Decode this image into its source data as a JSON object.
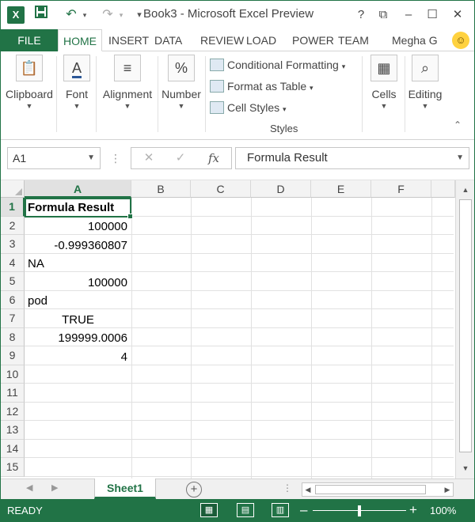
{
  "window": {
    "title": "Book3 - Microsoft Excel Preview",
    "logo": "X",
    "user": "Megha G"
  },
  "quick_access": {
    "save_icon": "save-icon",
    "undo_icon": "undo-icon",
    "redo_icon": "redo-icon",
    "customize_icon": "customize-icon"
  },
  "window_buttons": {
    "help_icon": "help-icon",
    "restore_icon": "ribbon-display-icon",
    "minimize_icon": "minimize-icon",
    "maximize_icon": "maximize-icon",
    "close_icon": "close-icon"
  },
  "ribbon_tabs": [
    "FILE",
    "HOME",
    "INSERT",
    "DATA",
    "REVIEW",
    "LOAD",
    "POWER",
    "TEAM"
  ],
  "ribbon": {
    "clipboard": "Clipboard",
    "font": "Font",
    "alignment": "Alignment",
    "number": "Number",
    "conditional_formatting": "Conditional Formatting",
    "format_as_table": "Format as Table",
    "cell_styles": "Cell Styles",
    "styles_group": "Styles",
    "cells": "Cells",
    "editing": "Editing"
  },
  "formula_bar": {
    "name_box": "A1",
    "formula": "Formula Result"
  },
  "columns": [
    "A",
    "B",
    "C",
    "D",
    "E",
    "F"
  ],
  "rows": [
    "1",
    "2",
    "3",
    "4",
    "5",
    "6",
    "7",
    "8",
    "9",
    "10",
    "11",
    "12",
    "13",
    "14",
    "15"
  ],
  "cells": {
    "a1": "Formula Result",
    "a2": "100000",
    "a3": "-0.999360807",
    "a4": "NA",
    "a5": "100000",
    "a6": "pod",
    "a7": "TRUE",
    "a8": "199999.0006",
    "a9": "4"
  },
  "sheets": [
    "Sheet1"
  ],
  "status": {
    "mode": "READY",
    "zoom": "100%"
  },
  "colors": {
    "accent": "#217346"
  }
}
